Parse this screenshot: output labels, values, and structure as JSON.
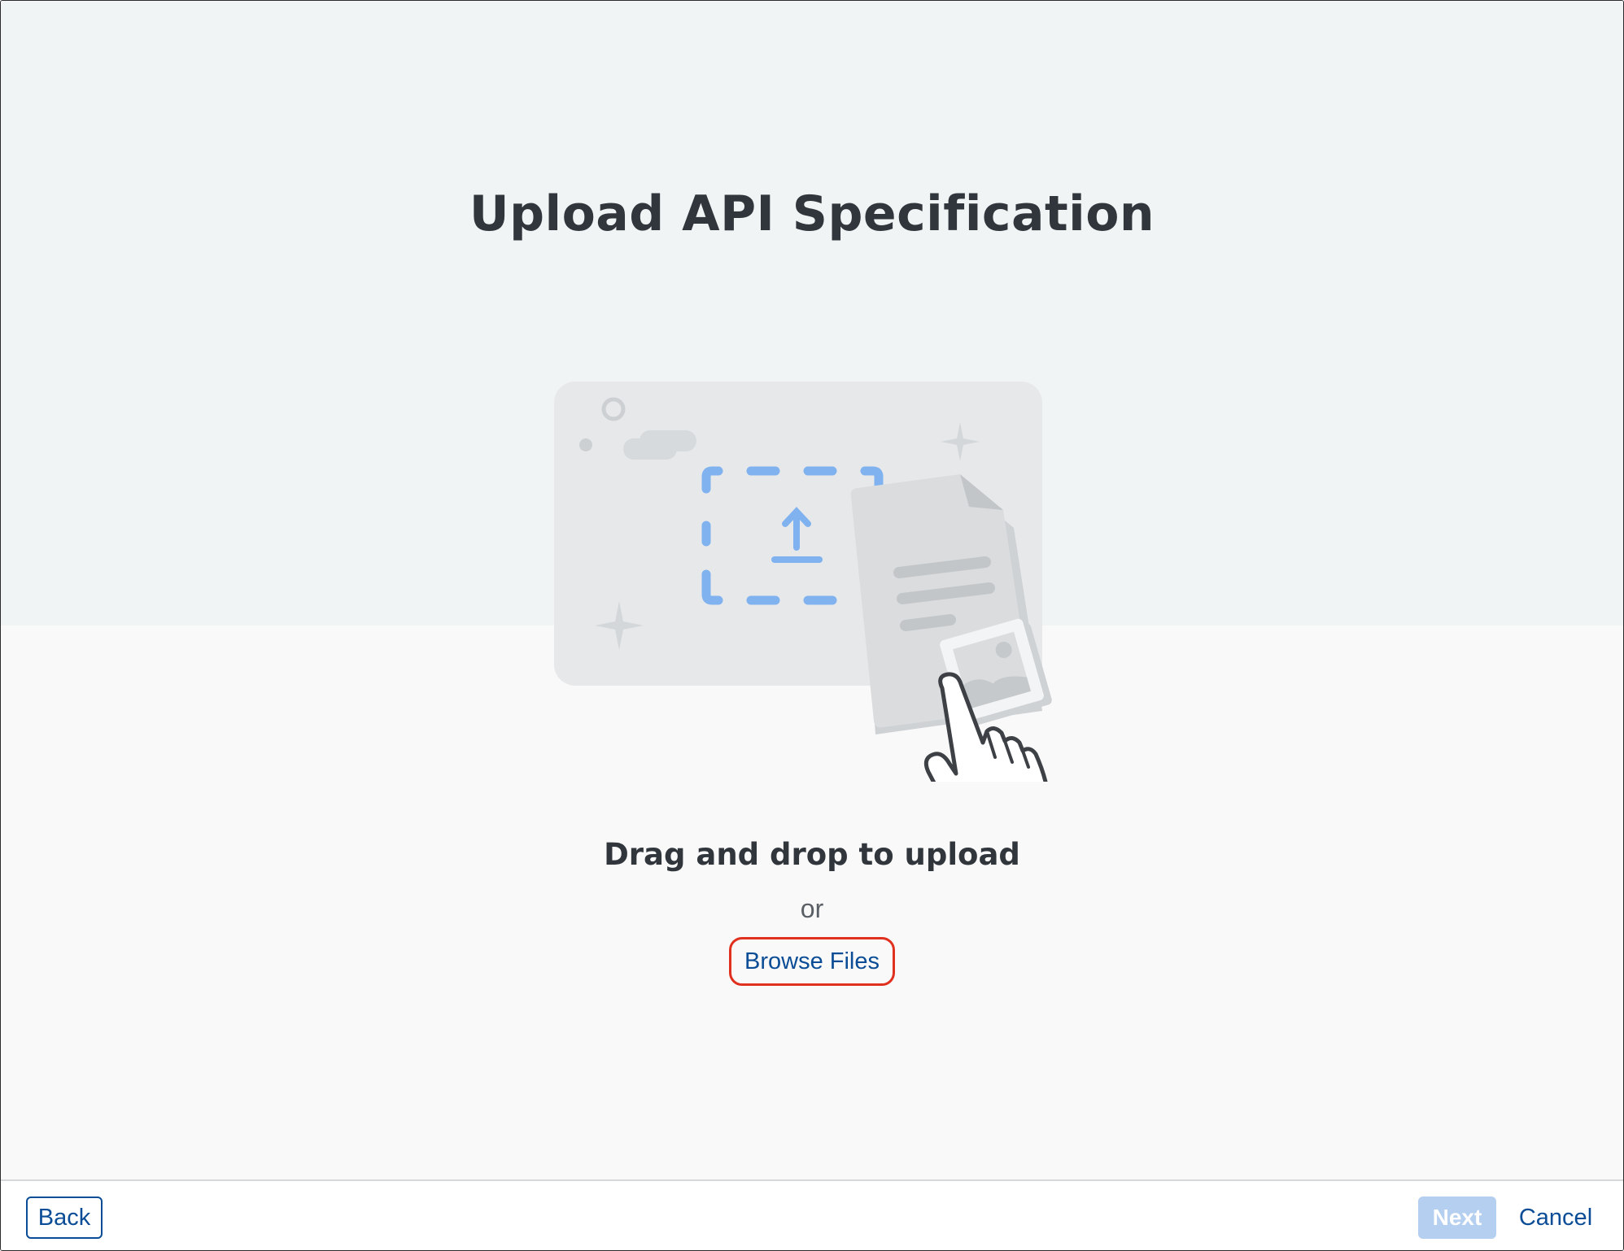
{
  "page": {
    "title": "Upload API Specification"
  },
  "upload": {
    "heading": "Drag and drop to upload",
    "or_text": "or",
    "browse_label": "Browse Files",
    "illustration_icon": "upload-illustration"
  },
  "footer": {
    "back_label": "Back",
    "next_label": "Next",
    "cancel_label": "Cancel"
  },
  "colors": {
    "accent": "#0a4d96",
    "highlight_border": "#e0301e",
    "next_disabled_bg": "#b4cff0",
    "dashed_upload": "#7fb2ee",
    "title_text": "#30363c"
  }
}
